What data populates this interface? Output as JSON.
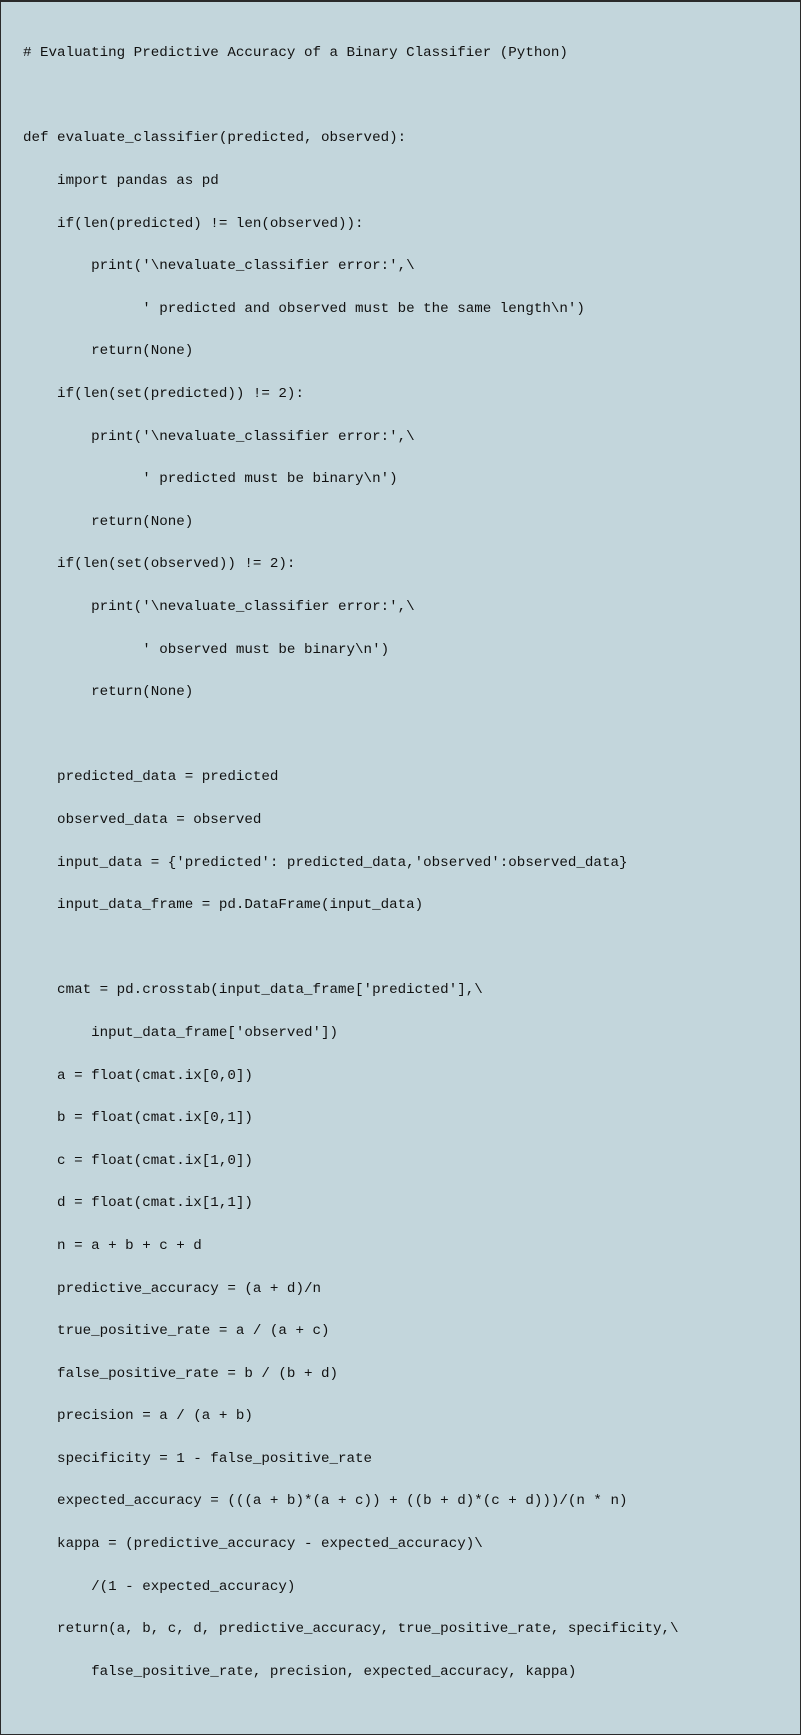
{
  "code": {
    "l01": "# Evaluating Predictive Accuracy of a Binary Classifier (Python)",
    "l02": "",
    "l03": "def evaluate_classifier(predicted, observed):",
    "l04": "    import pandas as pd",
    "l05": "    if(len(predicted) != len(observed)):",
    "l06": "        print('\\nevaluate_classifier error:',\\",
    "l07": "              ' predicted and observed must be the same length\\n')",
    "l08": "        return(None)",
    "l09": "    if(len(set(predicted)) != 2):",
    "l10": "        print('\\nevaluate_classifier error:',\\",
    "l11": "              ' predicted must be binary\\n')",
    "l12": "        return(None)",
    "l13": "    if(len(set(observed)) != 2):",
    "l14": "        print('\\nevaluate_classifier error:',\\",
    "l15": "              ' observed must be binary\\n')",
    "l16": "        return(None)",
    "l17": "",
    "l18": "    predicted_data = predicted",
    "l19": "    observed_data = observed",
    "l20": "    input_data = {'predicted': predicted_data,'observed':observed_data}",
    "l21": "    input_data_frame = pd.DataFrame(input_data)",
    "l22": "",
    "l23": "    cmat = pd.crosstab(input_data_frame['predicted'],\\",
    "l24": "        input_data_frame['observed'])",
    "l25": "    a = float(cmat.ix[0,0])",
    "l26": "    b = float(cmat.ix[0,1])",
    "l27": "    c = float(cmat.ix[1,0])",
    "l28": "    d = float(cmat.ix[1,1])",
    "l29": "    n = a + b + c + d",
    "l30": "    predictive_accuracy = (a + d)/n",
    "l31": "    true_positive_rate = a / (a + c)",
    "l32": "    false_positive_rate = b / (b + d)",
    "l33": "    precision = a / (a + b)",
    "l34": "    specificity = 1 - false_positive_rate",
    "l35": "    expected_accuracy = (((a + b)*(a + c)) + ((b + d)*(c + d)))/(n * n)",
    "l36": "    kappa = (predictive_accuracy - expected_accuracy)\\",
    "l37": "        /(1 - expected_accuracy)",
    "l38": "    return(a, b, c, d, predictive_accuracy, true_positive_rate, specificity,\\",
    "l39": "        false_positive_rate, precision, expected_accuracy, kappa)"
  }
}
